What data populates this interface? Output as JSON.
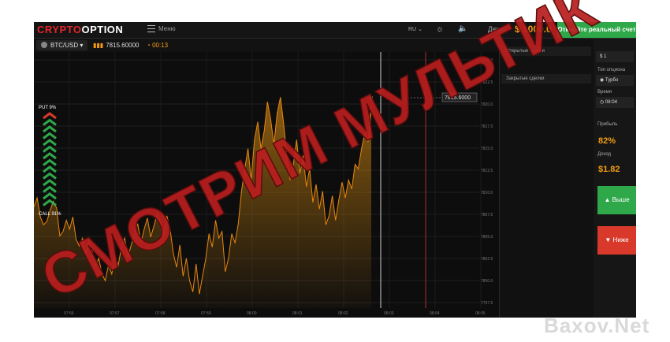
{
  "header": {
    "logo_part1": "CRYPTO",
    "logo_part2": "OPTION",
    "menu_label": "Меню",
    "language": "RU",
    "demo_label": "Демо",
    "balance": "$ 1000.0",
    "real_account_button": "Откройте реальный счет"
  },
  "toolbar": {
    "asset": "BTC/USD",
    "current_price": "7815.60000",
    "timer": "00:13"
  },
  "chart": {
    "put_label": "PUT 9%",
    "call_label": "CALL 91%",
    "price_tag": "7815.6000",
    "y_ticks": [
      "7825.0",
      "7822.5",
      "7820.0",
      "7817.5",
      "7815.0",
      "7812.5",
      "7810.0",
      "7807.5",
      "7805.0",
      "7802.5",
      "7800.0",
      "7797.5"
    ],
    "x_ticks": [
      "07:56",
      "07:57",
      "07:58",
      "07:59",
      "08:00",
      "08:01",
      "08:02",
      "08:03",
      "08:04",
      "08:05"
    ],
    "series": [
      6,
      14,
      -3,
      -10,
      -7,
      3,
      11,
      5,
      -20,
      -16,
      -6,
      -14,
      -3,
      -23,
      -29,
      -22,
      -36,
      -24,
      -34,
      -47,
      -40,
      -54,
      -60,
      -46,
      -54,
      -38,
      -46,
      -30,
      -22,
      -39,
      -28,
      -18,
      -9,
      -26,
      -14,
      -4,
      -21,
      -11,
      0,
      -8,
      -20,
      -2,
      -14,
      -36,
      -48,
      -28,
      -56,
      -40,
      -60,
      -70,
      -45,
      -72,
      -56,
      -40,
      -18,
      -30,
      -6,
      -22,
      -16,
      -52,
      -40,
      -18,
      -26,
      -9,
      20,
      40,
      58,
      30,
      66,
      82,
      58,
      74,
      100,
      84,
      62,
      90,
      104,
      80,
      50,
      30,
      44,
      66,
      36,
      52,
      24,
      40,
      10,
      26,
      4,
      20,
      -10,
      -2,
      16,
      -6,
      12,
      28,
      14,
      30,
      22,
      44,
      40,
      58,
      72,
      64,
      96
    ]
  },
  "positions": {
    "open_trades": "Открытые сделки",
    "closed_trades": "Закрытые сделки"
  },
  "trade_panel": {
    "field1": "$ 1",
    "type_label": "Тип опциона",
    "type_value": "Турбо",
    "expiry_label": "Время",
    "expiry_value": "08:04",
    "profit_label": "Прибыль",
    "profit_value": "82%",
    "income_label": "Доход",
    "income_value": "$1.82",
    "up_button": "Выше",
    "down_button": "Ниже"
  },
  "watermark": {
    "stamp_text": "СМОТРИМ МУЛЬТИК",
    "site": "Baxov.Net"
  },
  "colors": {
    "accent": "#f39c12",
    "green": "#2fa84a",
    "red": "#d9392a",
    "brand_red": "#e0262b"
  }
}
